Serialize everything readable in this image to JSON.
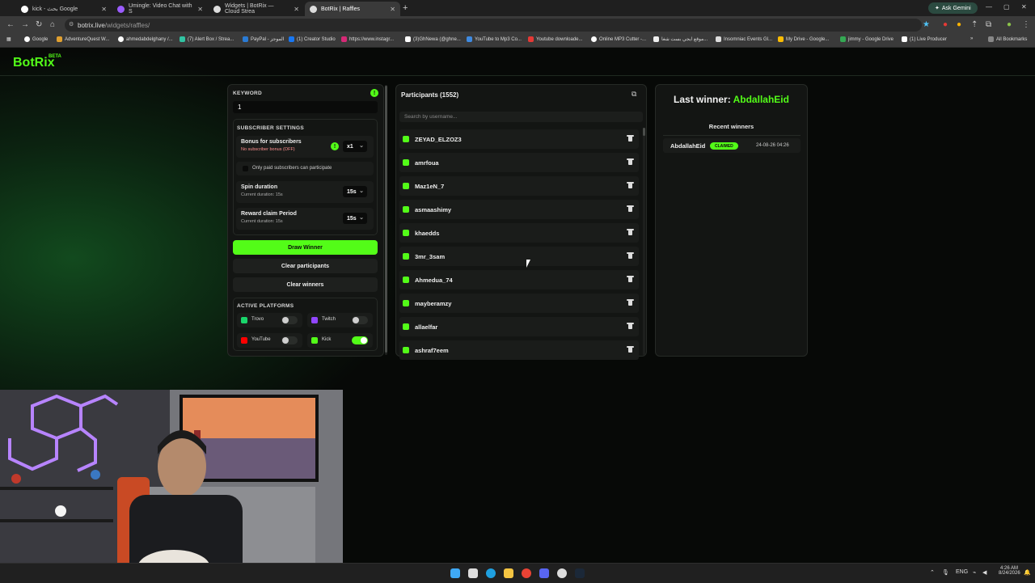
{
  "browser": {
    "tabs": [
      {
        "title": "kick - بحث Google",
        "active": false
      },
      {
        "title": "Uminglе: Video Chat with S",
        "active": false
      },
      {
        "title": "Widgets | BotRix — Cloud Strea",
        "active": false
      },
      {
        "title": "BotRix | Raffles",
        "active": true
      }
    ],
    "gemini_label": "Ask Gemini",
    "url_host": "botrix.live",
    "url_path": "/widgets/raffles/",
    "bookmarks": [
      "Google",
      "AdventureQuest W...",
      "ahmedabdelghany /...",
      "(7) Alert Box / Strea...",
      "PayPal - الموجز",
      "(1) Creator Studio",
      "https://www.instagr...",
      "(3)GhNewa (@ghne...",
      "YouTube to Mp3 Co...",
      "Youtube downloade...",
      "Online MP3 Cutter -...",
      "موقع ايجي بست شغا...",
      "Insomniac Events Gl...",
      "My Drive - Google...",
      "jimmy - Google Drive",
      "(1) Live Producer"
    ],
    "all_bookmarks": "All Bookmarks"
  },
  "app": {
    "logo": "BotRix",
    "logo_badge": "BETA"
  },
  "settings": {
    "keyword_label": "KEYWORD",
    "keyword_value": "1",
    "subscriber_settings_label": "SUBSCRIBER SETTINGS",
    "bonus_title": "Bonus for subscribers",
    "bonus_sub": "No subscriber bonus (OFF)",
    "bonus_value": "x1",
    "paid_only_label": "Only paid subscribers can participate",
    "spin_title": "Spin duration",
    "spin_sub": "Current duration: 15s",
    "spin_value": "15s",
    "reward_title": "Reward claim Period",
    "reward_sub": "Current duration: 15s",
    "reward_value": "15s",
    "draw_winner": "Draw Winner",
    "clear_participants": "Clear participants",
    "clear_winners": "Clear winners",
    "active_platforms_label": "ACTIVE PLATFORMS",
    "platforms": [
      {
        "name": "Trovo",
        "on": false,
        "color": "#19d66b"
      },
      {
        "name": "Twitch",
        "on": false,
        "color": "#9146ff"
      },
      {
        "name": "YouTube",
        "on": false,
        "color": "#ff0000"
      },
      {
        "name": "Kick",
        "on": true,
        "color": "#53fc18"
      }
    ]
  },
  "participants": {
    "title": "Participants (1552)",
    "search_placeholder": "Search by username...",
    "list": [
      "ZEYAD_ELZOZ3",
      "amrfoua",
      "Maz1eN_7",
      "asmaashimy",
      "khaedds",
      "3mr_3sam",
      "Ahmedua_74",
      "mayberamzy",
      "allaelfar",
      "ashraf7eem"
    ]
  },
  "winners": {
    "last_winner_label": "Last winner:",
    "last_winner_name": "AbdallahEid",
    "recent_label": "Recent winners",
    "recent": [
      {
        "name": "AbdallahEid",
        "status": "CLAIMED",
        "time": "24-08-26 04:26"
      }
    ]
  },
  "taskbar": {
    "lang": "ENG",
    "time": "4:26 AM",
    "date": "8/24/2026"
  },
  "colors": {
    "accent": "#53fc18",
    "panel": "#131513"
  }
}
